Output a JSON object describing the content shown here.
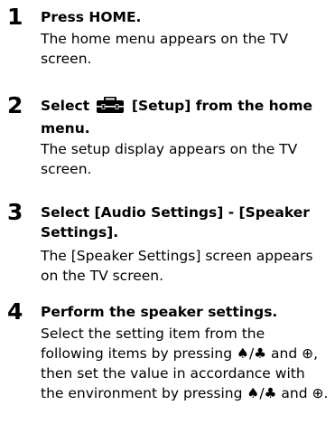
{
  "steps": [
    {
      "number": "1",
      "title": "Press HOME.",
      "description": "The home menu appears on the TV screen."
    },
    {
      "number": "2",
      "title_prefix": "Select",
      "title_icon": "toolbox-icon",
      "title_suffix": "[Setup] from the home menu.",
      "description": "The setup display appears on the TV screen."
    },
    {
      "number": "3",
      "title": "Select [Audio Settings] - [Speaker Settings].",
      "description": "The [Speaker Settings] screen appears on the TV screen."
    },
    {
      "number": "4",
      "title": "Perform the speaker settings.",
      "desc_part1": "Select the setting item from the following items by pressing",
      "desc_arrows_1": "♠/♣",
      "desc_part2": "and",
      "desc_enter_1": "⊕",
      "desc_part3": ", then set the value in accordance with the environment by pressing",
      "desc_arrows_2": "♠/♣",
      "desc_part4": "and",
      "desc_enter_2": "⊕",
      "desc_part5": ".",
      "arrow_icon": "up-down-arrow-icon",
      "enter_icon": "enter-circle-plus-icon"
    }
  ]
}
